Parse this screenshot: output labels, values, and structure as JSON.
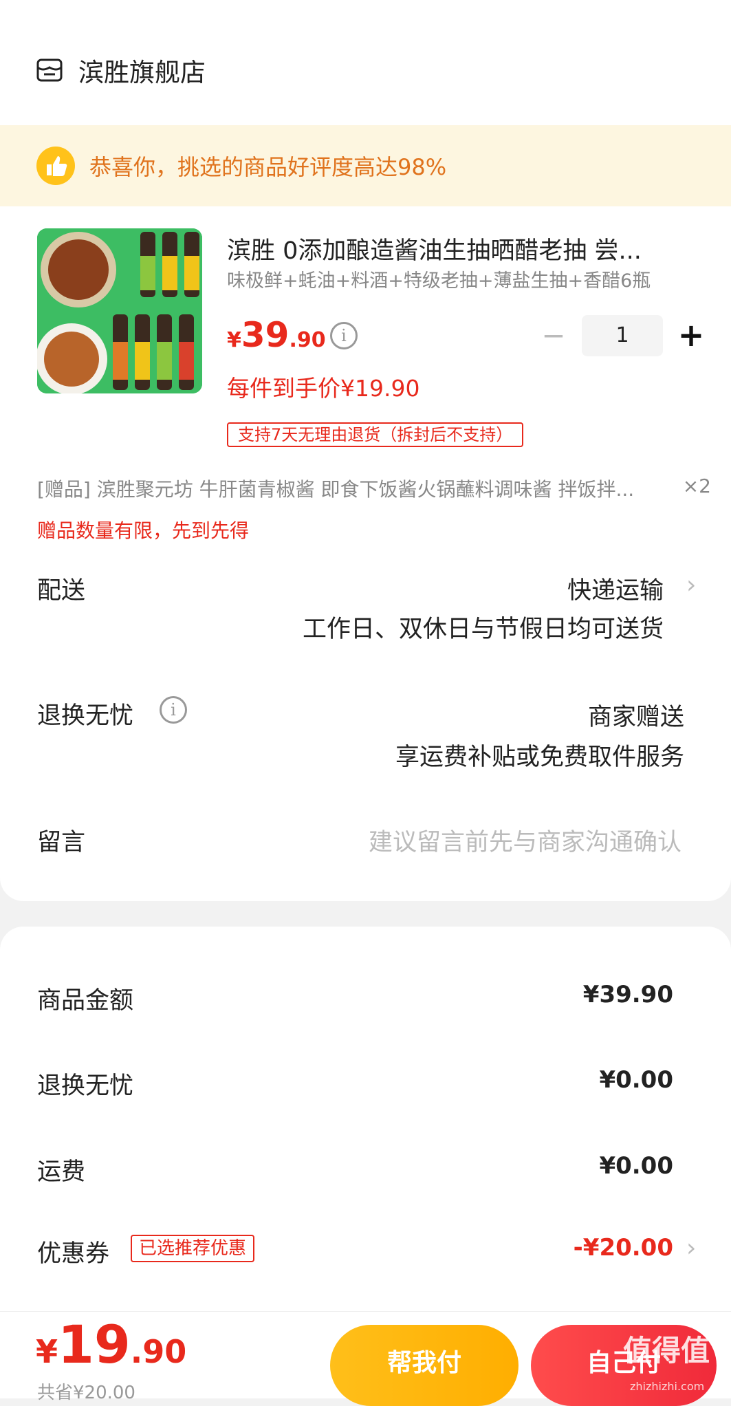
{
  "store": {
    "name": "滨胜旗舰店",
    "icon": "store-icon"
  },
  "banner": {
    "text": "恭喜你，挑选的商品好评度高达98%",
    "icon": "thumbs-up-icon",
    "color": "#e0731d"
  },
  "product": {
    "title": "滨胜 0添加酿造酱油生抽晒醋老抽 尝...",
    "spec": "味极鲜+蚝油+料酒+特级老抽+薄盐生抽+香醋6瓶",
    "price_currency": "¥",
    "price_int": "39",
    "price_dec": ".90",
    "quantity": "1",
    "minus": "−",
    "plus": "+",
    "per_item_price": "每件到手价¥19.90",
    "return_tag": "支持7天无理由退货（拆封后不支持）"
  },
  "gift": {
    "text": "[赠品]  滨胜聚元坊 牛肝菌青椒酱 即食下饭酱火锅蘸料调味酱 拌饭拌...",
    "qty": "×2",
    "note": "赠品数量有限，先到先得"
  },
  "delivery": {
    "label": "配送",
    "method": "快递运输",
    "detail": "工作日、双休日与节假日均可送货"
  },
  "return_worry": {
    "label": "退换无忧",
    "value1": "商家赠送",
    "value2": "享运费补贴或免费取件服务"
  },
  "message": {
    "label": "留言",
    "placeholder": "建议留言前先与商家沟通确认"
  },
  "summary": {
    "goods_label": "商品金额",
    "goods_value": "¥39.90",
    "return_label": "退换无忧",
    "return_value": "¥0.00",
    "shipping_label": "运费",
    "shipping_value": "¥0.00",
    "coupon_label": "优惠券",
    "coupon_tag": "已选推荐优惠",
    "coupon_value": "-¥20.00"
  },
  "bottom": {
    "total_currency": "¥",
    "total_int": "19",
    "total_dec": ".90",
    "saved": "共省¥20.00",
    "help_pay": "帮我付",
    "self_pay": "自己付"
  },
  "watermark": {
    "main": "值得值",
    "sub": "zhizhizhi.com"
  },
  "colors": {
    "accent_red": "#e8291c",
    "orange": "#e0731d",
    "yellow_button": "#ffb400",
    "red_button": "#f02a3a"
  }
}
